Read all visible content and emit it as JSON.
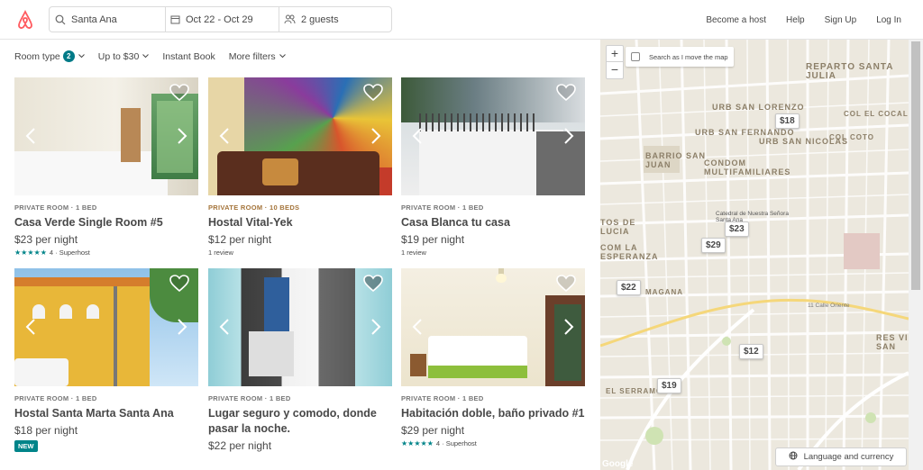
{
  "header": {
    "logo_icon": "airbnb-logo-icon",
    "search": {
      "where": "Santa Ana",
      "dates": "Oct 22 - Oct 29",
      "guests": "2 guests"
    },
    "nav": [
      "Become a host",
      "Help",
      "Sign Up",
      "Log In"
    ]
  },
  "filters": {
    "room_type": "Room type",
    "room_type_count": "2",
    "price": "Up to $30",
    "instant_book": "Instant Book",
    "more": "More filters"
  },
  "listings": [
    {
      "kicker": "PRIVATE ROOM · 1 BED",
      "title": "Casa Verde Single Room #5",
      "price": "$23 per night",
      "stars": "★★★★★",
      "meta": "4 · Superhost"
    },
    {
      "kicker": "PRIVATE ROOM · 10 BEDS",
      "title": "Hostal Vital-Yek",
      "price": "$12 per night",
      "meta": "1 review"
    },
    {
      "kicker": "PRIVATE ROOM · 1 BED",
      "title": "Casa Blanca tu casa",
      "price": "$19 per night",
      "meta": "1 review"
    },
    {
      "kicker": "PRIVATE ROOM · 1 BED",
      "title": "Hostal Santa Marta Santa Ana",
      "price": "$18 per night",
      "badge": "NEW"
    },
    {
      "kicker": "PRIVATE ROOM · 1 BED",
      "title": "Lugar seguro y comodo, donde pasar la noche.",
      "price": "$22 per night"
    },
    {
      "kicker": "PRIVATE ROOM · 1 BED",
      "title": "Habitación doble, baño privado #1",
      "price": "$29 per night",
      "stars": "★★★★★",
      "meta": "4 · Superhost"
    }
  ],
  "map": {
    "zoom_in": "+",
    "zoom_out": "−",
    "search_as_move": "Search as I move the map",
    "pins": [
      "$18",
      "$23",
      "$29",
      "$22",
      "$12",
      "$19"
    ],
    "labels": [
      "REPARTO SANTA JULIA",
      "URB SAN LORENZO",
      "URB SAN FERNANDO",
      "URB SAN NICOLAS",
      "COL EL COCAL",
      "COL COTO",
      "BARRIO SAN JUAN",
      "CONDOM MULTIFAMILIARES",
      "TOS DE LUCIA",
      "COM LA ESPERANZA",
      "MAGANA",
      "RES VI SAN",
      "EL SERRAMONO",
      "Catedral de Nuestra Señora Santa Ana",
      "11 Calle Oriente"
    ],
    "lang": "Language and currency",
    "google": "Google"
  }
}
